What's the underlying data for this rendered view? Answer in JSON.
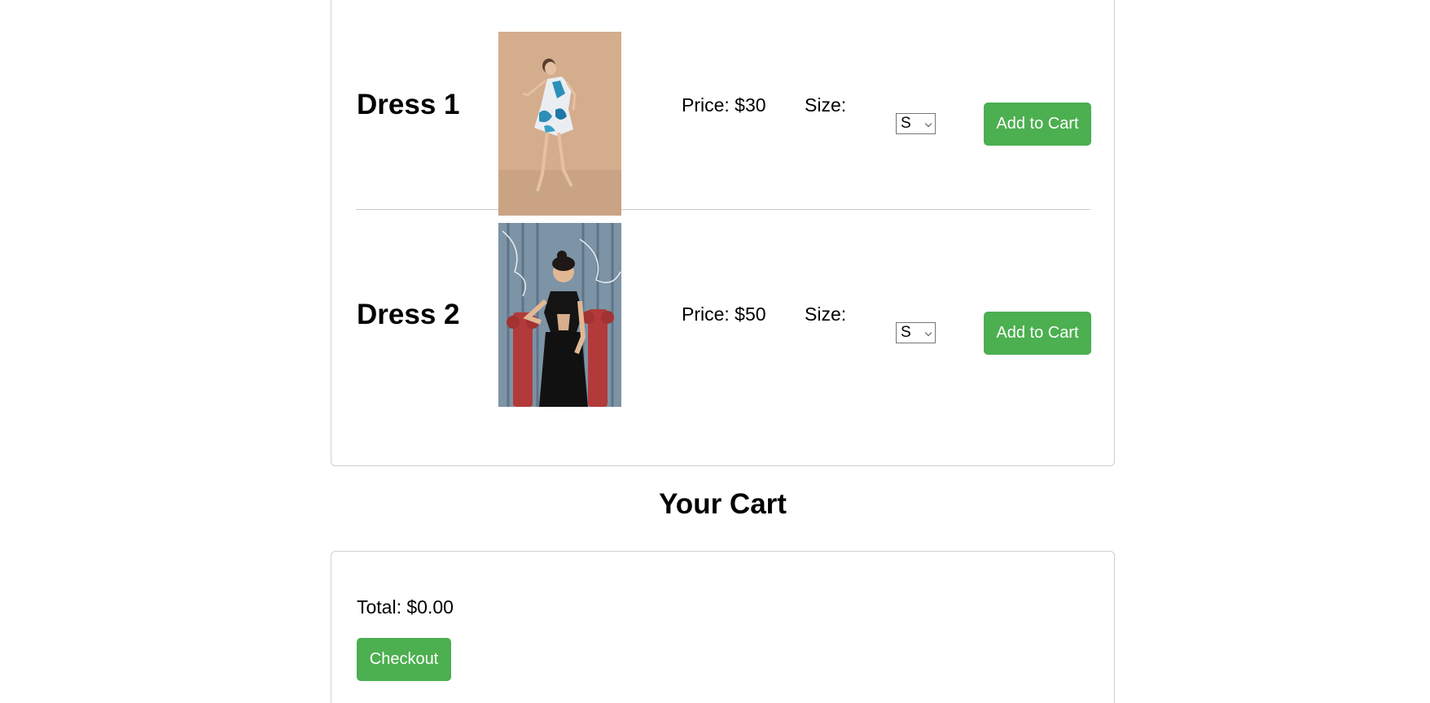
{
  "products": [
    {
      "name": "Dress 1",
      "price_text": "Price: $30",
      "size_label": "Size:",
      "size_selected": "S",
      "add_label": "Add to Cart",
      "image": "woman-in-blue-white-printed-dress-photo"
    },
    {
      "name": "Dress 2",
      "price_text": "Price: $50",
      "size_label": "Size:",
      "size_selected": "S",
      "add_label": "Add to Cart",
      "image": "woman-in-black-halter-dress-photo"
    }
  ],
  "cart": {
    "title": "Your Cart",
    "total_text": "Total: $0.00",
    "checkout_label": "Checkout"
  },
  "colors": {
    "button_green": "#4caf50",
    "panel_border": "#d0d0d0"
  }
}
